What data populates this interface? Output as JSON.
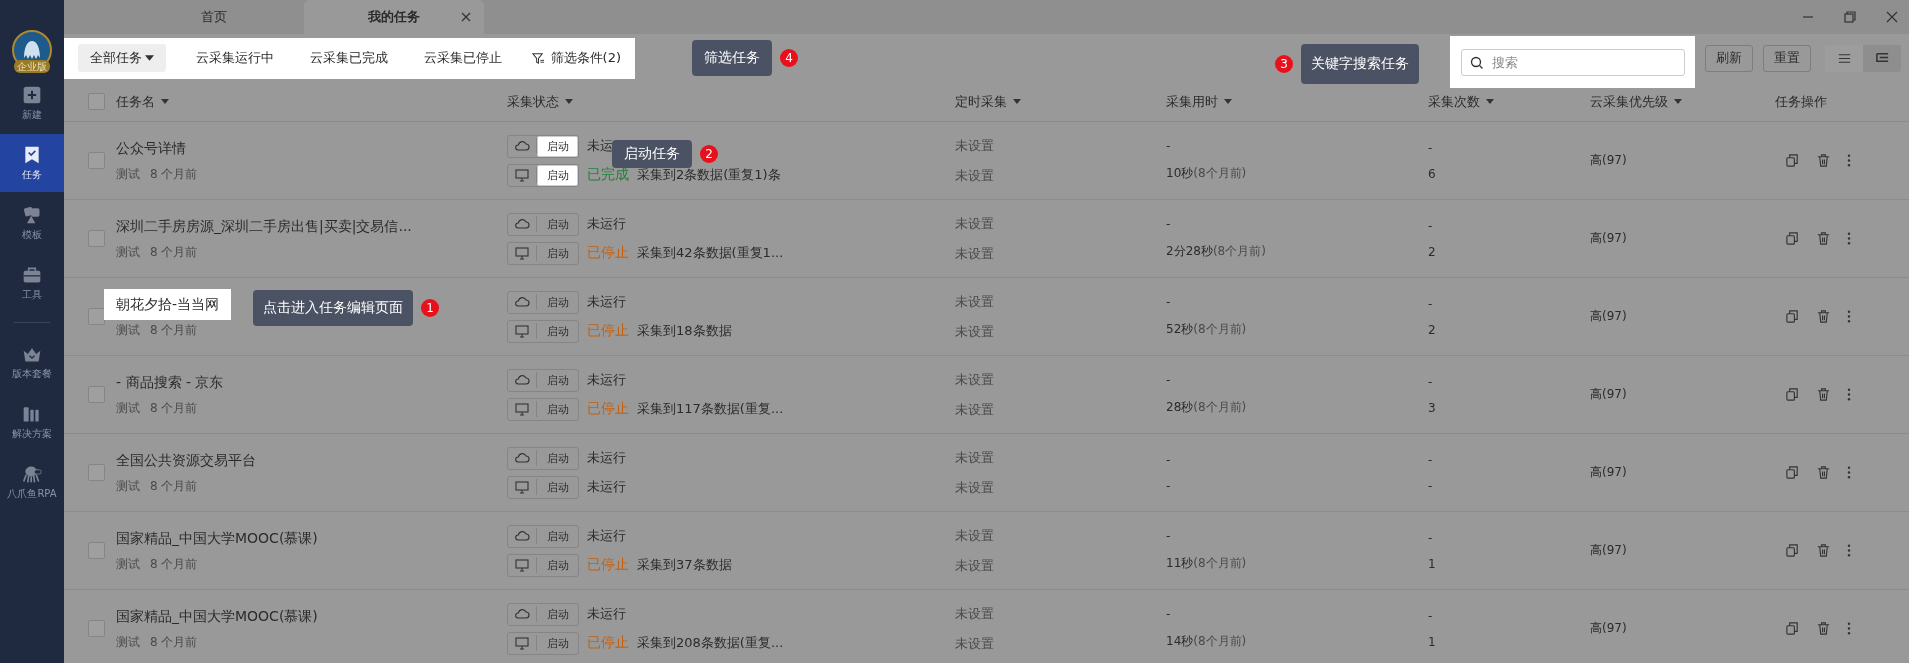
{
  "sidebar": {
    "badge": "企业版",
    "items": [
      {
        "kind": "new",
        "label": "新建",
        "selected": false
      },
      {
        "kind": "task",
        "label": "任务",
        "selected": true
      },
      {
        "kind": "template",
        "label": "模板",
        "selected": false
      },
      {
        "kind": "tools",
        "label": "工具",
        "selected": false
      },
      {
        "kind": "plan",
        "label": "版本套餐",
        "selected": false
      },
      {
        "kind": "solution",
        "label": "解决方案",
        "selected": false
      },
      {
        "kind": "rpa",
        "label": "八爪鱼RPA",
        "selected": false
      }
    ]
  },
  "tabs": [
    {
      "label": "首页",
      "selected": false,
      "closable": false
    },
    {
      "label": "我的任务",
      "selected": true,
      "closable": true
    }
  ],
  "toolbar": {
    "dropdown": "全部任务",
    "filters": [
      "云采集运行中",
      "云采集已完成",
      "云采集已停止"
    ],
    "filter_conditions": "筛选条件(2)",
    "search": {
      "placeholder": "搜索"
    },
    "buttons": [
      "刷新",
      "重置"
    ],
    "views": [
      {
        "kind": "list",
        "selected": true
      },
      {
        "kind": "tree",
        "selected": false
      }
    ]
  },
  "table": {
    "select_all_checked": false,
    "columns": [
      {
        "label": "任务名",
        "sortable": true
      },
      {
        "label": "采集状态",
        "sortable": true
      },
      {
        "label": "定时采集",
        "sortable": true
      },
      {
        "label": "采集用时",
        "sortable": true
      },
      {
        "label": "采集次数",
        "sortable": true
      },
      {
        "label": "云采集优先级",
        "sortable": true
      },
      {
        "label": "任务操作",
        "sortable": false
      }
    ],
    "rows": [
      {
        "checked": false,
        "name": "公众号详情",
        "name_highlighted": false,
        "start_highlighted": true,
        "group": "测试",
        "age": "8 个月前",
        "cloud": {
          "button": "启动",
          "color": "#2b2b2b",
          "text": "未运"
        },
        "local": {
          "button": "启动",
          "color": "#23803a",
          "label": "已完成",
          "text": "采集到2条数据(重复1)条"
        },
        "schedule": [
          "未设置",
          "未设置"
        ],
        "duration": [
          {
            "value": "-"
          },
          {
            "value": "10秒",
            "ago": "(8个月前)"
          }
        ],
        "runs": [
          "-",
          "6"
        ],
        "priority": "高(97)"
      },
      {
        "checked": false,
        "name": "深圳二手房房源_深圳二手房出售|买卖|交易信...",
        "name_highlighted": false,
        "start_highlighted": false,
        "group": "测试",
        "age": "8 个月前",
        "cloud": {
          "button": "启动",
          "color": "#2b2b2b",
          "text": "未运行"
        },
        "local": {
          "button": "启动",
          "color": "#c4600f",
          "label": "已停止",
          "text": "采集到42条数据(重复1..."
        },
        "schedule": [
          "未设置",
          "未设置"
        ],
        "duration": [
          {
            "value": "-"
          },
          {
            "value": "2分28秒",
            "ago": "(8个月前)"
          }
        ],
        "runs": [
          "-",
          "2"
        ],
        "priority": "高(97)"
      },
      {
        "checked": false,
        "name": "朝花夕拾-当当网",
        "name_highlighted": true,
        "start_highlighted": false,
        "group": "测试",
        "age": "8 个月前",
        "cloud": {
          "button": "启动",
          "color": "#2b2b2b",
          "text": "未运行"
        },
        "local": {
          "button": "启动",
          "color": "#c4600f",
          "label": "已停止",
          "text": "采集到18条数据"
        },
        "schedule": [
          "未设置",
          "未设置"
        ],
        "duration": [
          {
            "value": "-"
          },
          {
            "value": "52秒",
            "ago": "(8个月前)"
          }
        ],
        "runs": [
          "-",
          "2"
        ],
        "priority": "高(97)"
      },
      {
        "checked": false,
        "name": "- 商品搜索 - 京东",
        "name_highlighted": false,
        "start_highlighted": false,
        "group": "测试",
        "age": "8 个月前",
        "cloud": {
          "button": "启动",
          "color": "#2b2b2b",
          "text": "未运行"
        },
        "local": {
          "button": "启动",
          "color": "#c4600f",
          "label": "已停止",
          "text": "采集到117条数据(重复..."
        },
        "schedule": [
          "未设置",
          "未设置"
        ],
        "duration": [
          {
            "value": "-"
          },
          {
            "value": "28秒",
            "ago": "(8个月前)"
          }
        ],
        "runs": [
          "-",
          "3"
        ],
        "priority": "高(97)"
      },
      {
        "checked": false,
        "name": "全国公共资源交易平台",
        "name_highlighted": false,
        "start_highlighted": false,
        "group": "测试",
        "age": "8 个月前",
        "cloud": {
          "button": "启动",
          "color": "#2b2b2b",
          "text": "未运行"
        },
        "local": {
          "button": "启动",
          "color": "#2b2b2b",
          "text": "未运行"
        },
        "schedule": [
          "未设置",
          "未设置"
        ],
        "duration": [
          {
            "value": "-"
          },
          {
            "value": "-"
          }
        ],
        "runs": [
          "-",
          "-"
        ],
        "priority": "高(97)"
      },
      {
        "checked": false,
        "name": "国家精品_中国大学MOOC(慕课)",
        "name_highlighted": false,
        "start_highlighted": false,
        "group": "测试",
        "age": "8 个月前",
        "cloud": {
          "button": "启动",
          "color": "#2b2b2b",
          "text": "未运行"
        },
        "local": {
          "button": "启动",
          "color": "#c4600f",
          "label": "已停止",
          "text": "采集到37条数据"
        },
        "schedule": [
          "未设置",
          "未设置"
        ],
        "duration": [
          {
            "value": "-"
          },
          {
            "value": "11秒",
            "ago": "(8个月前)"
          }
        ],
        "runs": [
          "-",
          "1"
        ],
        "priority": "高(97)"
      },
      {
        "checked": false,
        "name": "国家精品_中国大学MOOC(慕课)",
        "name_highlighted": false,
        "start_highlighted": false,
        "group": "测试",
        "age": "8 个月前",
        "cloud": {
          "button": "启动",
          "color": "#2b2b2b",
          "text": "未运行"
        },
        "local": {
          "button": "启动",
          "color": "#c4600f",
          "label": "已停止",
          "text": "采集到208条数据(重复..."
        },
        "schedule": [
          "未设置",
          "未设置"
        ],
        "duration": [
          {
            "value": "-"
          },
          {
            "value": "14秒",
            "ago": "(8个月前)"
          }
        ],
        "runs": [
          "-",
          "1"
        ],
        "priority": "高(97)"
      }
    ]
  },
  "tour_steps": [
    {
      "number": "1",
      "text": "点击进入任务编辑页面"
    },
    {
      "number": "2",
      "text": "启动任务"
    },
    {
      "number": "3",
      "text": "关键字搜索任务"
    },
    {
      "number": "4",
      "text": "筛选任务"
    }
  ]
}
